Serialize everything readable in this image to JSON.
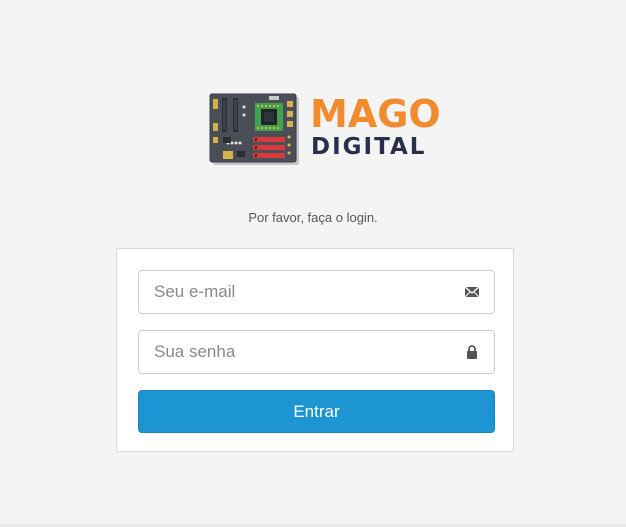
{
  "brand": {
    "name_line1": "MAGO",
    "name_line2": "DIGITAL",
    "accent_color": "#f28a2e",
    "dark_color": "#2b2e4a"
  },
  "login": {
    "prompt": "Por favor, faça o login.",
    "email_placeholder": "Seu e-mail",
    "email_icon": "envelope-icon",
    "password_placeholder": "Sua senha",
    "password_icon": "lock-icon",
    "submit_label": "Entrar",
    "button_color": "#1e95d3"
  }
}
